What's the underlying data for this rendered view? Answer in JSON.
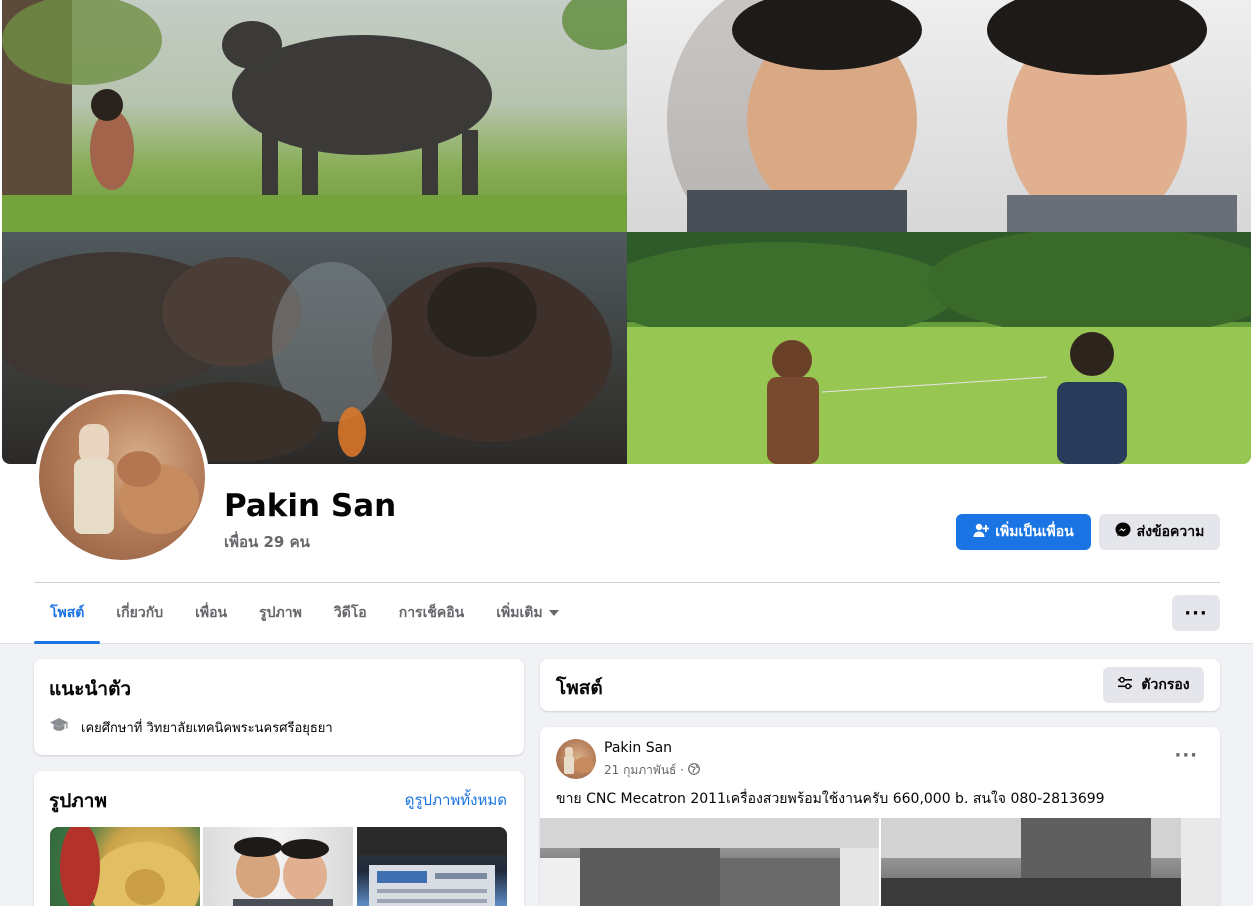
{
  "profile": {
    "name": "Pakin San",
    "friends_count": "เพื่อน 29 คน",
    "add_friend_label": "เพิ่มเป็นเพื่อน",
    "message_label": "ส่งข้อความ"
  },
  "tabs": [
    {
      "label": "โพสต์",
      "active": true
    },
    {
      "label": "เกี่ยวกับ"
    },
    {
      "label": "เพื่อน"
    },
    {
      "label": "รูปภาพ"
    },
    {
      "label": "วิดีโอ"
    },
    {
      "label": "การเช็คอิน"
    },
    {
      "label": "เพิ่มเติม"
    }
  ],
  "more_button": "···",
  "intro": {
    "title": "แนะนำตัว",
    "education": "เคยศึกษาที่ วิทยาลัยเทคนิคพระนครศรีอยุธยา"
  },
  "photos": {
    "title": "รูปภาพ",
    "see_all": "ดูรูปภาพทั้งหมด"
  },
  "posts": {
    "title": "โพสต์",
    "filter_label": "ตัวกรอง"
  },
  "post": {
    "author": "Pakin San",
    "date": "21 กุมภาพันธ์ ·",
    "text": "ขาย CNC Mecatron 2011เครื่องสวยพร้อมใช้งานครับ  660,000 b. สนใจ 080-2813699",
    "more": "···"
  },
  "colors": {
    "accent": "#1b74e4",
    "page_bg": "#f0f2f5",
    "secondary_button": "#e4e6eb",
    "muted_text": "#65676b"
  }
}
